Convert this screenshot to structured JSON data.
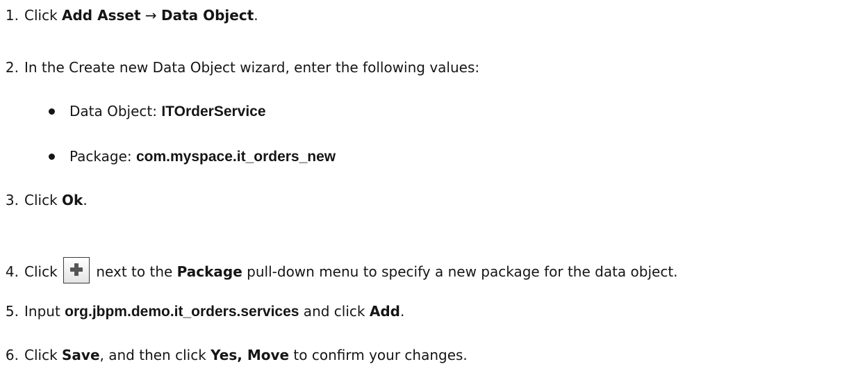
{
  "steps": [
    {
      "num": "1.",
      "pre": "Click ",
      "b1": "Add Asset",
      "mid": " → ",
      "b2": "Data Object",
      "post": "."
    },
    {
      "num": "2.",
      "text": "In the Create new Data Object wizard, enter the following values:"
    },
    {
      "num": "3.",
      "pre": "Click ",
      "b1": "Ok",
      "post": "."
    },
    {
      "num": "4.",
      "pre": "Click ",
      "mid": " next to the ",
      "b1": "Package",
      "post": " pull-down menu to specify a new package for the data object."
    },
    {
      "num": "5.",
      "pre": "Input ",
      "code": "org.jbpm.demo.it_orders.services",
      "mid": " and click ",
      "b1": "Add",
      "post": "."
    },
    {
      "num": "6.",
      "pre": "Click ",
      "b1": "Save",
      "mid": ", and then click ",
      "b2": "Yes, Move",
      "post": " to confirm your changes."
    }
  ],
  "bullets": [
    {
      "label": "Data Object: ",
      "value": "ITOrderService"
    },
    {
      "label": "Package: ",
      "value": "com.myspace.it_orders_new"
    }
  ],
  "icons": {
    "add_button": "plus-icon"
  }
}
